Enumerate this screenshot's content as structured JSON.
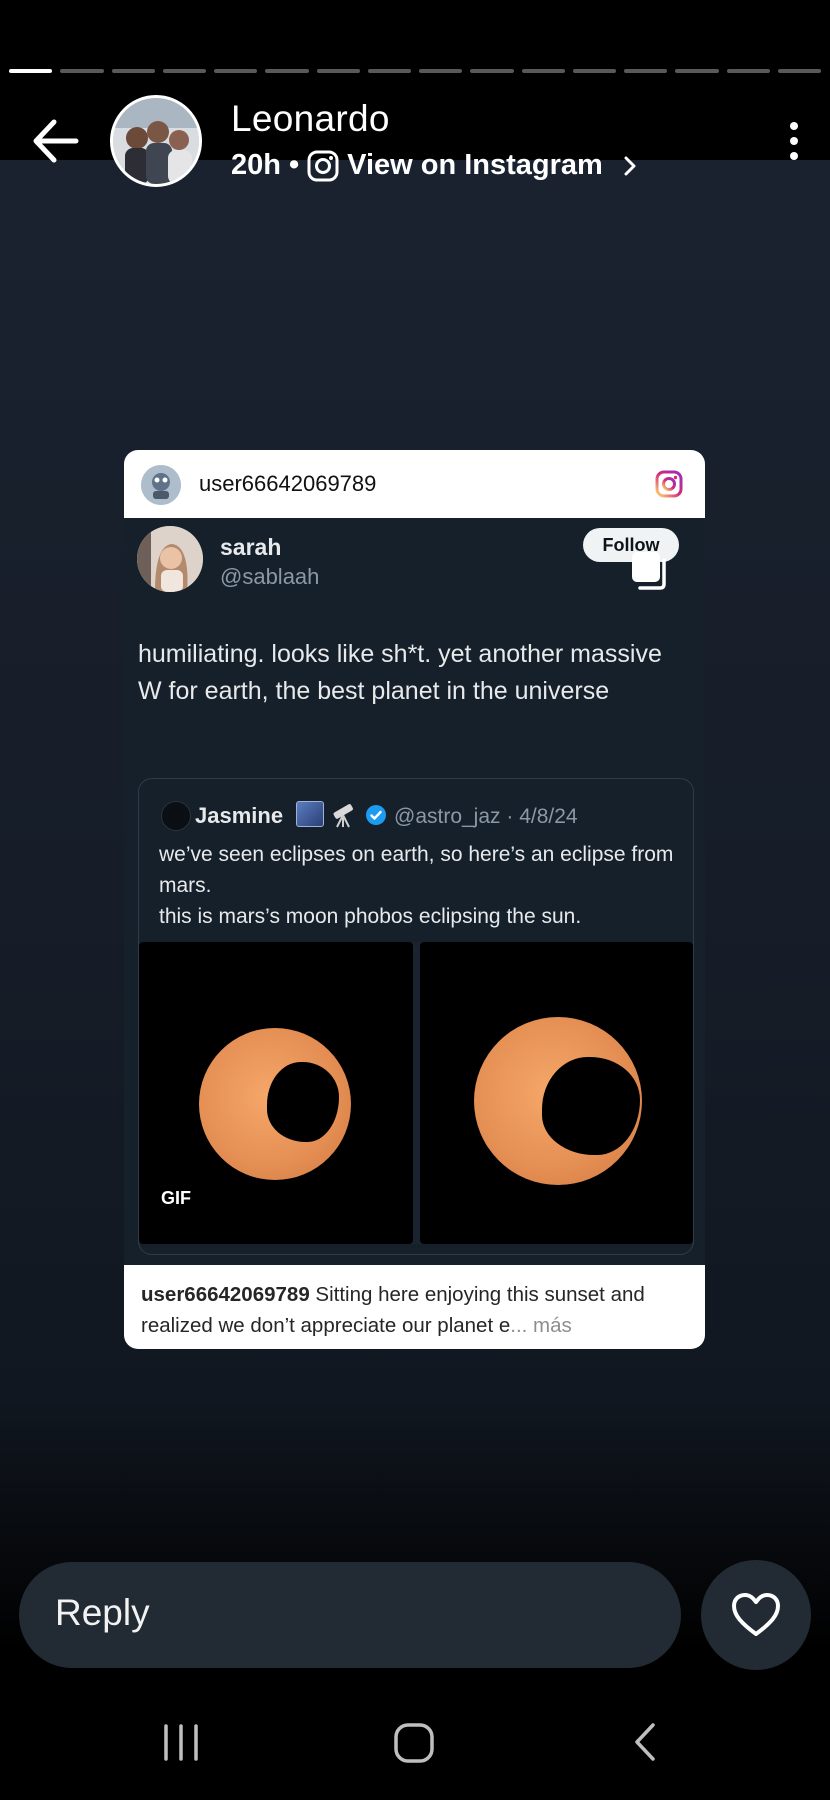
{
  "story": {
    "progress_segments_total": 16,
    "progress_segments_done": 1,
    "author_name": "Leonardo",
    "time_ago": "20h",
    "separator": "•",
    "view_on_label": "View on Instagram"
  },
  "post": {
    "header_user": "user66642069789",
    "tweet": {
      "name": "sarah",
      "handle": "@sablaah",
      "follow_label": "Follow",
      "text": "humiliating. looks like sh*t. yet another massive W for earth, the best planet in the universe"
    },
    "quote": {
      "name": "Jasmine",
      "handle_date": "@astro_jaz · 4/8/24",
      "text_line1": "we’ve seen eclipses on earth, so here’s an eclipse from mars.",
      "text_line2": "this is mars’s moon phobos eclipsing the sun.",
      "gif_badge": "GIF"
    },
    "caption": {
      "user": "user66642069789",
      "text": "Sitting here enjoying this sunset and realized we don’t appreciate our planet e",
      "ellipsis": "...",
      "more_label": "más"
    }
  },
  "footer": {
    "reply_placeholder": "Reply"
  },
  "colors": {
    "accent_verified": "#1d9bf0",
    "sun": "#e48e53",
    "instagram_gradient": [
      "#feda75",
      "#d62976",
      "#962fbf"
    ]
  },
  "icons": [
    "back-arrow-icon",
    "instagram-icon",
    "chevron-right-icon",
    "more-vertical-icon",
    "heart-icon",
    "recent-apps-icon",
    "home-icon",
    "back-nav-icon",
    "verified-icon",
    "telescope-icon",
    "copy-icon"
  ]
}
